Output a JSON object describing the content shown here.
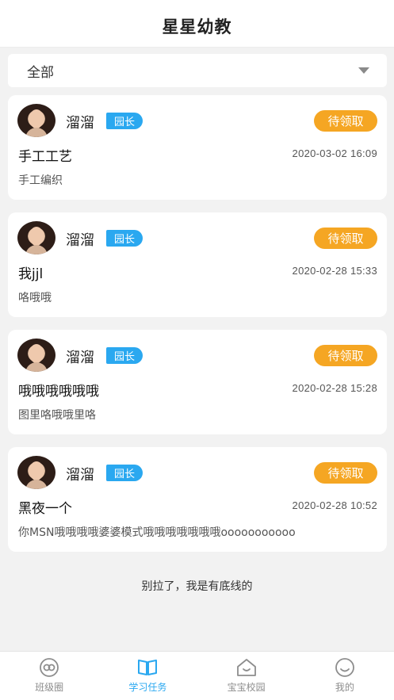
{
  "header": {
    "title": "星星幼教"
  },
  "filter": {
    "selected": "全部"
  },
  "tasks": [
    {
      "name": "溜溜",
      "role": "园长",
      "status": "待领取",
      "title": "手工工艺",
      "time": "2020-03-02 16:09",
      "desc": "手工编织"
    },
    {
      "name": "溜溜",
      "role": "园长",
      "status": "待领取",
      "title": "我jjl",
      "time": "2020-02-28 15:33",
      "desc": "咯哦哦"
    },
    {
      "name": "溜溜",
      "role": "园长",
      "status": "待领取",
      "title": "哦哦哦哦哦哦",
      "time": "2020-02-28 15:28",
      "desc": "图里咯哦哦里咯"
    },
    {
      "name": "溜溜",
      "role": "园长",
      "status": "待领取",
      "title": "黑夜一个",
      "time": "2020-02-28 10:52",
      "desc": "你MSN哦哦哦哦婆婆模式哦哦哦哦哦哦哦ooooooooooo"
    }
  ],
  "footer_note": "别拉了，我是有底线的",
  "tabbar": {
    "items": [
      {
        "label": "班级圈",
        "icon": "circle-link-icon"
      },
      {
        "label": "学习任务",
        "icon": "book-icon"
      },
      {
        "label": "宝宝校园",
        "icon": "school-house-icon"
      },
      {
        "label": "我的",
        "icon": "smiley-icon"
      }
    ],
    "active_color": "#2aa8f0",
    "inactive_color": "#8d8d8d"
  },
  "colors": {
    "status": "#f5a623",
    "role_badge": "#2aa8f0"
  }
}
